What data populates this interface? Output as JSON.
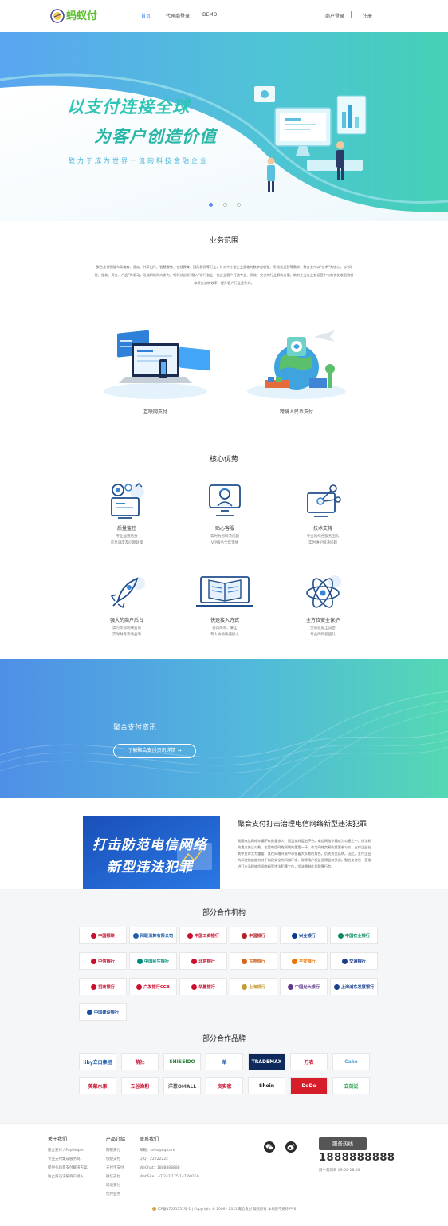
{
  "nav": {
    "logo_text": "蚂蚁付",
    "links": [
      "首页",
      "代理商登录",
      "DEMO"
    ],
    "right": [
      "商户登录",
      "注册"
    ]
  },
  "hero": {
    "line1": "以支付连接全球",
    "line2": "为客户创造价值",
    "subtitle": "致力于成为世界一流的科技金融企业",
    "slide_count": 3,
    "active_slide": 1
  },
  "business": {
    "title": "业务范围",
    "description": "聚合支付积极布局电商、酒店、共享出行、智慧零售、在线教育、国际贸易等行业，针对中小型企业面临的数字化转型、系统化运营等需求，聚合支付以“技术”为核心，以“风控、服务、资金、产品”为驱动，形成四轮同向发力，将科技创新“融入”各行各业，为企业客户打造专业、高效、安全的行业解决方案，助力企业在业务运营中有效优化收银流程和资金流转效率，提升客户行业竞争力。",
    "cards": [
      {
        "label": "互联网支付",
        "icon": "laptop-payment-illustration"
      },
      {
        "label": "跨境人民币支付",
        "icon": "globe-crossborder-illustration"
      }
    ]
  },
  "advantages": {
    "title": "核心优势",
    "items": [
      {
        "title": "质量监控",
        "desc1": "专业运营后台",
        "desc2": "应急调度及问题处理",
        "icon": "monitor-gear-icon"
      },
      {
        "title": "贴心客服",
        "desc1": "实时为您解决问题",
        "desc2": "VIP服务全年无休",
        "icon": "customer-service-icon"
      },
      {
        "title": "技术支持",
        "desc1": "专业的综合服务团队",
        "desc2": "实时维护解决问题",
        "icon": "tech-network-icon"
      },
      {
        "title": "强大的商户后台",
        "desc1": "实时交易明细查询",
        "desc2": "实时财务流动查询",
        "icon": "rocket-icon"
      },
      {
        "title": "快速接入方式",
        "desc1": "接口简单、安全",
        "desc2": "专人协助快速接入",
        "icon": "book-laptop-icon"
      },
      {
        "title": "全方位安全保护",
        "desc1": "交易数据全加密",
        "desc2": "专业的风控团队",
        "icon": "atom-icon"
      }
    ]
  },
  "banner": {
    "title": "聚合支付资讯",
    "button": "了解聚合支付资讯详情 →"
  },
  "news": {
    "image_line1": "打击防范电信网络",
    "image_line2": "新型违法犯罪",
    "title": "聚合支付打击治理电信网络新型违法犯罪",
    "body": "我国电信网络诈骗不仅数量惊人，而且花样层出不穷。电信网络诈骗成为公害之一，执法机构重点关注对象，也是电信网络领域的重要一环。作为网络交易的重要参与方，支付企业在其中显得尤为重要，其在网络环境中承担着大众数的角色，负责资金运转。因此，支付企业的风控措施能力对于构建安全的网络环境、保障用户权益显得极其关键。聚合支付也一直推进打击治理电信网络新型违法犯罪工作，坚决遏制此类犯罪行为。"
  },
  "partners": {
    "orgs_title": "部分合作机构",
    "orgs": [
      {
        "name": "中国银联",
        "color": "#c8102e"
      },
      {
        "name": "网联清算有限公司",
        "color": "#1d5fa8"
      },
      {
        "name": "中国工商银行",
        "color": "#c8102e"
      },
      {
        "name": "中国银行",
        "color": "#b21f24"
      },
      {
        "name": "兴业银行",
        "color": "#0a3a8c"
      },
      {
        "name": "中国农业银行",
        "color": "#0f8a5f"
      },
      {
        "name": "中信银行",
        "color": "#c8102e"
      },
      {
        "name": "中国民生银行",
        "color": "#008a7a"
      },
      {
        "name": "北京银行",
        "color": "#c8102e"
      },
      {
        "name": "东莞银行",
        "color": "#d4661e"
      },
      {
        "name": "平安银行",
        "color": "#ee7202"
      },
      {
        "name": "交通银行",
        "color": "#1a3e8e"
      },
      {
        "name": "招商银行",
        "color": "#c8102e"
      },
      {
        "name": "广发银行CGB",
        "color": "#c8102e"
      },
      {
        "name": "华夏银行",
        "color": "#c8102e"
      },
      {
        "name": "上海银行",
        "color": "#c59d36"
      },
      {
        "name": "中国光大银行",
        "color": "#5f3a8a"
      },
      {
        "name": "上海浦东发展银行",
        "color": "#1b3f8e"
      },
      {
        "name": "中国建设银行",
        "color": "#1b4fa0"
      }
    ],
    "brands_title": "部分合作品牌",
    "brands": [
      {
        "name": "liby立白集团",
        "color": "#1d5fa8"
      },
      {
        "name": "萌社",
        "color": "#c8102e"
      },
      {
        "name": "SHISEIDO",
        "color": "#2a7f3a"
      },
      {
        "name": "单",
        "color": "#1d5fa8"
      },
      {
        "name": "TRADEMAX",
        "color": "#ffffff",
        "bg": "#0e2a5c"
      },
      {
        "name": "万表",
        "color": "#c8102e"
      },
      {
        "name": "Cake",
        "color": "#4fa3d1"
      },
      {
        "name": "美菜水果",
        "color": "#c8102e"
      },
      {
        "name": "五谷渔粉",
        "color": "#c8102e"
      },
      {
        "name": "洋葱OMALL",
        "color": "#555555"
      },
      {
        "name": "良实家",
        "color": "#c8102e"
      },
      {
        "name": "Shein",
        "color": "#111111"
      },
      {
        "name": "DeDe",
        "color": "#ffffff",
        "bg": "#d61e2b"
      },
      {
        "name": "立刻说",
        "color": "#2a9d4a"
      }
    ]
  },
  "footer": {
    "about": {
      "title": "关于我们",
      "items": [
        "聚合支付 / PayHelper",
        "专业支付集成服务商。",
        "提供多场景支付解决方案。",
        "防止商违法骗商户接入"
      ]
    },
    "products": {
      "title": "产品介绍",
      "items": [
        "网银支付",
        "快捷支付",
        "支付宝支付",
        "微信支付",
        "跨境支付",
        "代付业务"
      ]
    },
    "contact": {
      "title": "联系我们",
      "items": [
        "邮箱：kefu@qq.com",
        "Q Q：22222222",
        "WeChat：1888888888",
        "WebSite：47.242.175.147:60159"
      ]
    },
    "hotline_label": "服务热线",
    "hotline_number": "1888888888",
    "hotline_time": "周一到周日 09:00-18:00",
    "copyright": "ICP备17031751号-1 | Copyright © 2006 - 2021 聚合支付 版权所有 本站暂不支持IPV6"
  }
}
